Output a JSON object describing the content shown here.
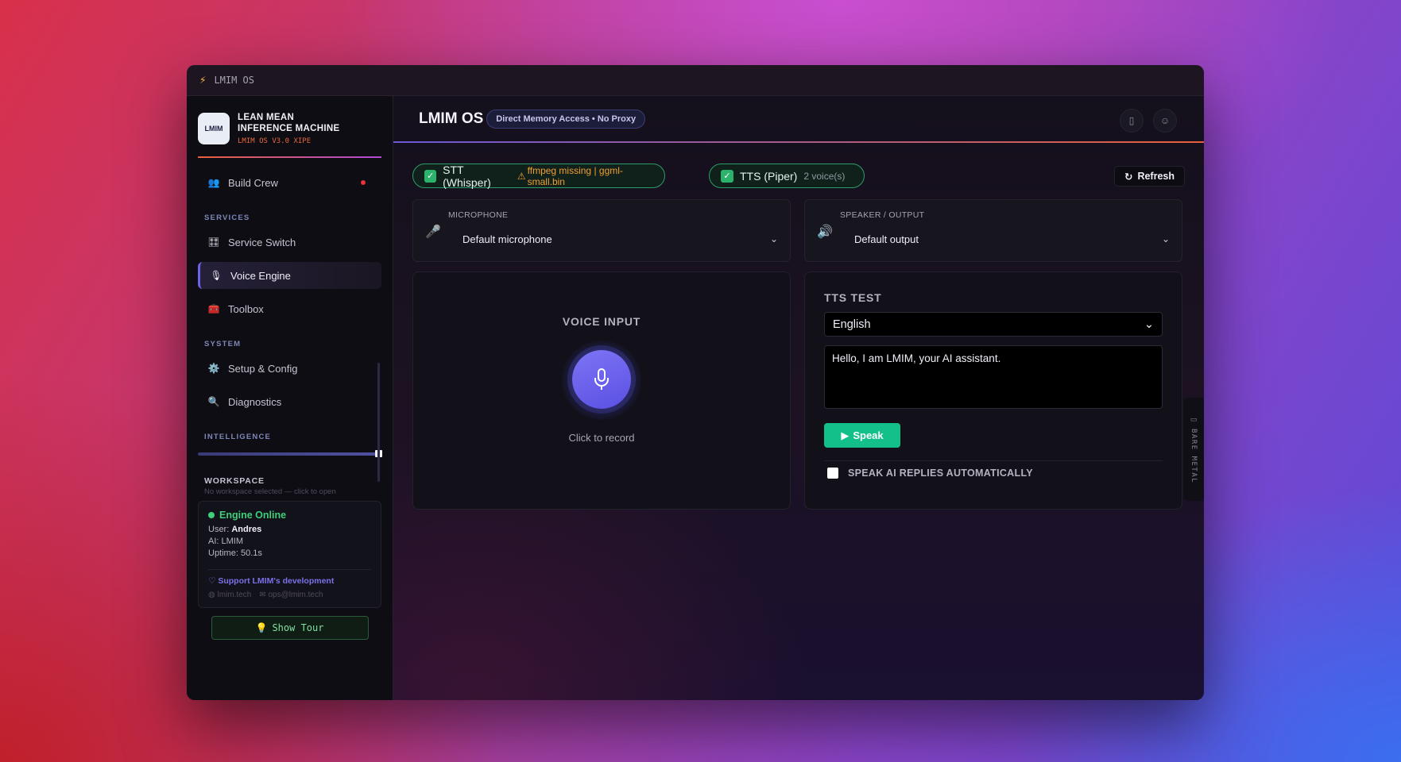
{
  "window": {
    "title": "LMIM OS"
  },
  "brand": {
    "line1": "LEAN MEAN",
    "line2": "INFERENCE MACHINE",
    "version": "LMIM OS V3.0 XIPE",
    "logo_text": "LMIM"
  },
  "sidebar": {
    "build_crew": "Build Crew",
    "services_label": "SERVICES",
    "service_switch": "Service Switch",
    "voice_engine": "Voice Engine",
    "toolbox": "Toolbox",
    "system_label": "SYSTEM",
    "setup_config": "Setup & Config",
    "diagnostics": "Diagnostics",
    "intelligence_label": "INTELLIGENCE",
    "workspace_label": "WORKSPACE",
    "workspace_hint": "No workspace selected — click to open",
    "engine_status": "Engine Online",
    "user_label": "User:",
    "user_value": "Andres",
    "ai_line": "AI: LMIM",
    "uptime_line": "Uptime: 50.1s",
    "support": "Support LMIM's development",
    "site": "lmim.tech",
    "email": "ops@lmim.tech",
    "show_tour": "Show Tour"
  },
  "header": {
    "title": "LMIM OS",
    "pill": "Direct Memory Access • No Proxy"
  },
  "status": {
    "stt_label": "STT (Whisper)",
    "stt_warning": "ffmpeg missing | ggml-small.bin",
    "tts_label": "TTS (Piper)",
    "tts_voices": "2 voice(s)",
    "refresh": "Refresh"
  },
  "devices": {
    "mic_label": "MICROPHONE",
    "mic_value": "Default microphone",
    "speaker_label": "SPEAKER / OUTPUT",
    "speaker_value": "Default output"
  },
  "voice_input": {
    "title": "VOICE INPUT",
    "hint": "Click to record"
  },
  "tts_test": {
    "title": "TTS TEST",
    "language": "English",
    "text": "Hello, I am LMIM, your AI assistant.",
    "speak": "Speak",
    "auto_speak": "SPEAK AI REPLIES AUTOMATICALLY"
  },
  "side_tab": {
    "label": "BARE METAL"
  },
  "colors": {
    "accent": "#6b63e8",
    "success": "#2cb36b",
    "speak_button": "#14c08a",
    "warning": "#f0a030",
    "brand_orange": "#e8683a"
  }
}
